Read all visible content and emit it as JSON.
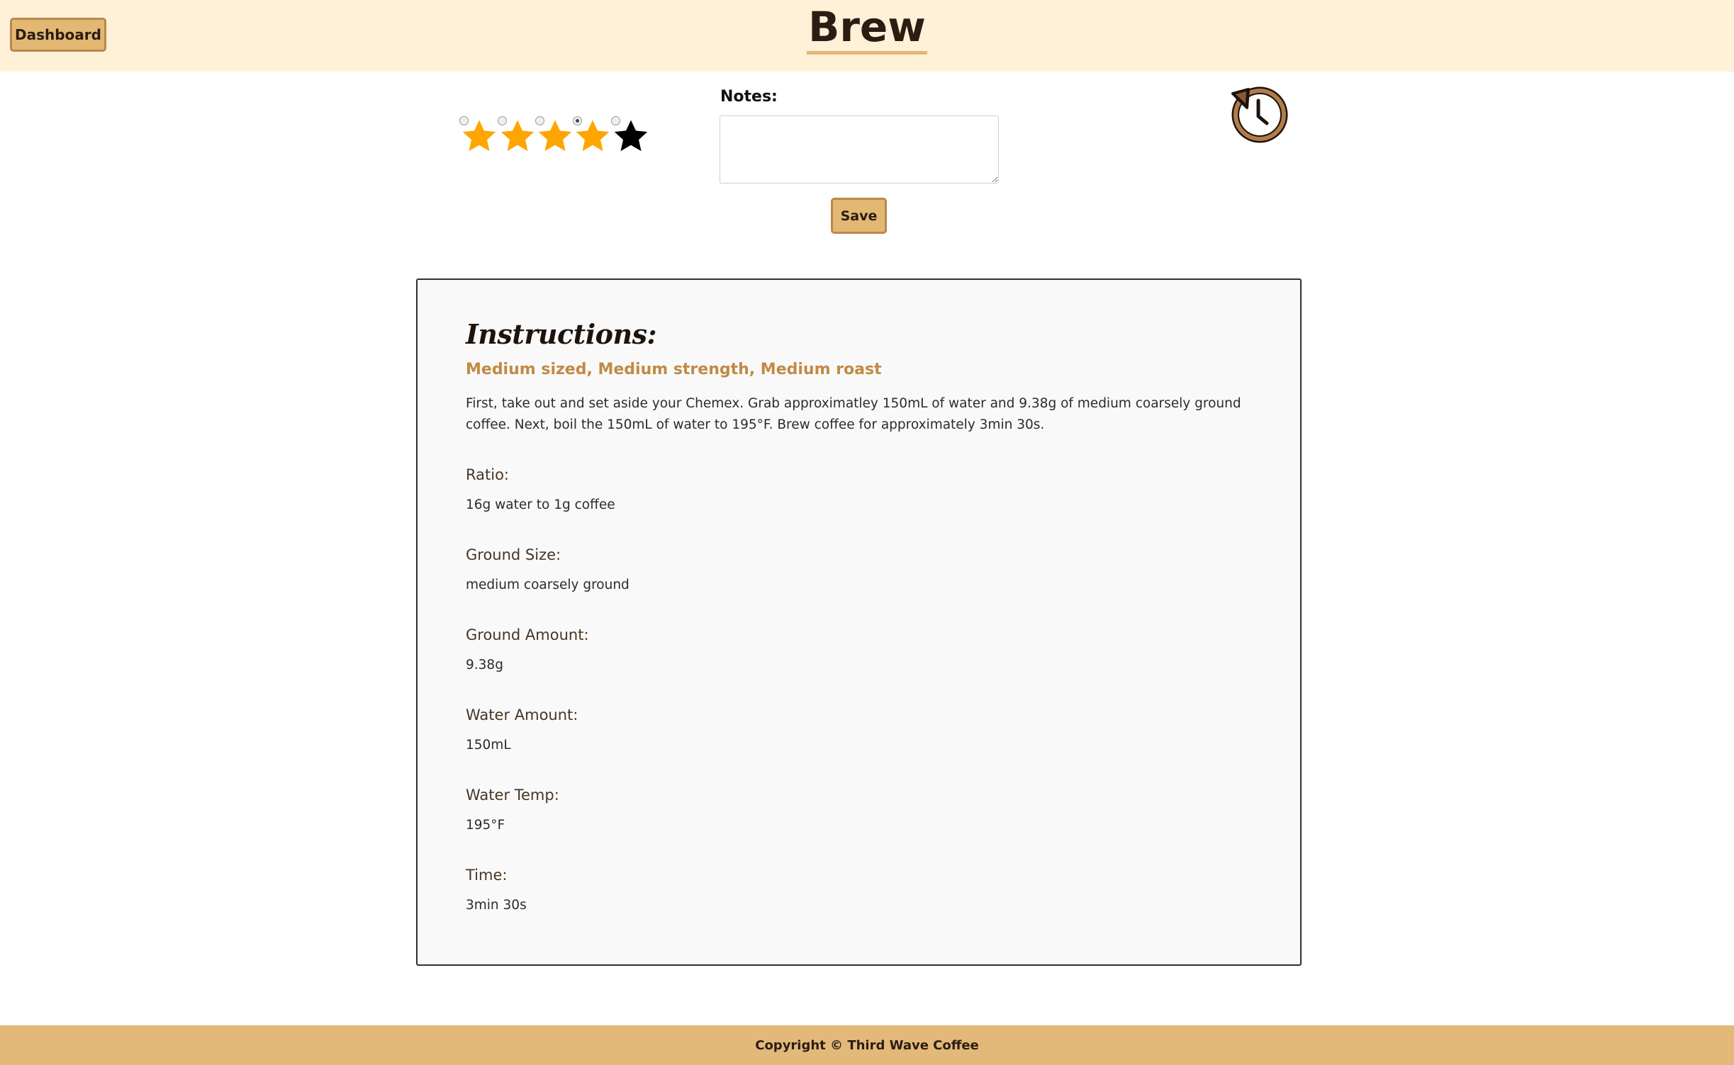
{
  "header": {
    "dashboard_label": "Dashboard",
    "title": "Brew"
  },
  "rating": {
    "value": 4,
    "max": 5,
    "filled_color": "#ffa500",
    "empty_color": "#000000"
  },
  "notes": {
    "label": "Notes:",
    "value": "",
    "save_label": "Save"
  },
  "history": {
    "icon": "history-icon",
    "color": "#b07c4a"
  },
  "instructions": {
    "heading": "Instructions:",
    "subtitle": "Medium sized, Medium strength, Medium roast",
    "body": "First, take out and set aside your Chemex. Grab approximatley 150mL of water and 9.38g of medium coarsely ground coffee. Next, boil the 150mL of water to 195°F. Brew coffee for approximately 3min 30s.",
    "fields": [
      {
        "label": "Ratio:",
        "value": "16g water to 1g coffee"
      },
      {
        "label": "Ground Size:",
        "value": "medium coarsely ground"
      },
      {
        "label": "Ground Amount:",
        "value": "9.38g"
      },
      {
        "label": "Water Amount:",
        "value": "150mL"
      },
      {
        "label": "Water Temp:",
        "value": "195°F"
      },
      {
        "label": "Time:",
        "value": "3min 30s"
      }
    ]
  },
  "footer": {
    "text": "Copyright © Third Wave Coffee"
  },
  "colors": {
    "header_bg": "#fff0d8",
    "accent": "#e3b873",
    "footer_bg": "#e3b97a",
    "subtitle": "#c18a45"
  }
}
